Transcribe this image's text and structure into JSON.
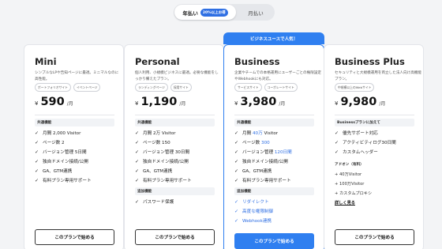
{
  "billing_toggle": {
    "annual_label": "年払い",
    "annual_badge": "20%以上お得",
    "monthly_label": "月払い"
  },
  "plans": [
    {
      "name": "Mini",
      "description": "シンプルなLPや告知ページに最適。ミニマルなのに高性能。",
      "tags": [
        "ポートフォリオサイト",
        "イベントページ"
      ],
      "currency": "¥",
      "price": "590",
      "per": "/月",
      "sections": [
        {
          "heading": "共通機能",
          "features": [
            {
              "text": "月間 2,000 Visitor"
            },
            {
              "text": "ページ数 2"
            },
            {
              "text": "バージョン管理 5日間"
            },
            {
              "text": "独自ドメイン接続/公開"
            },
            {
              "text": "GA、GTM連携"
            },
            {
              "text": "有料プラン専用サポート"
            }
          ]
        }
      ],
      "button": "このプランで始める"
    },
    {
      "name": "Personal",
      "description": "個人利用、小規模ビジネスに最適。必要な機能をしっかり備えたプラン。",
      "tags": [
        "ランディングページ",
        "採用サイト"
      ],
      "currency": "¥",
      "price": "1,190",
      "per": "/月",
      "sections": [
        {
          "heading": "共通機能",
          "features": [
            {
              "text": "月間 2万 Visitor"
            },
            {
              "text": "ページ数 150"
            },
            {
              "text": "バージョン管理 30日間"
            },
            {
              "text": "独自ドメイン接続/公開"
            },
            {
              "text": "GA、GTM連携"
            },
            {
              "text": "有料プラン専用サポート"
            }
          ]
        },
        {
          "heading": "追加機能",
          "features": [
            {
              "text": "パスワード保護"
            }
          ]
        }
      ],
      "button": "このプランで始める"
    },
    {
      "name": "Business",
      "banner": "ビジネスユースで人気！",
      "description": "企業やチームでの本格運用にユーザーごとの権限設定やWebhookにも対応。",
      "tags": [
        "サービスサイト",
        "コーポレートサイト"
      ],
      "currency": "¥",
      "price": "3,980",
      "per": "/月",
      "sections": [
        {
          "heading": "共通機能",
          "features": [
            {
              "text": "月間 ",
              "highlight": "40万",
              "suffix": " Visitor"
            },
            {
              "text": "ページ数 ",
              "highlight": "300",
              "suffix": ""
            },
            {
              "text": "バージョン管理 ",
              "highlight": "120日間",
              "suffix": ""
            },
            {
              "text": "独自ドメイン接続/公開"
            },
            {
              "text": "GA、GTM連携"
            },
            {
              "text": "有料プラン専用サポート"
            }
          ]
        },
        {
          "heading": "追加機能",
          "features": [
            {
              "text": "リダイレクト",
              "blue": true
            },
            {
              "text": "高度な権限制御",
              "blue": true
            },
            {
              "text": "Webhook連携",
              "blue": true
            }
          ]
        }
      ],
      "button": "このプランで始める"
    },
    {
      "name": "Business Plus",
      "description": "セキュリティと大規模運用を両立した法人向け高機能プラン。",
      "tags": [
        "中規模以上のWebサイト"
      ],
      "currency": "¥",
      "price": "9,980",
      "per": "/月",
      "sections": [
        {
          "heading": "Businessプランに加えて",
          "features": [
            {
              "text": "優先サポート対応"
            },
            {
              "text": "アクティビティログ30日間"
            },
            {
              "text": "カスタムヘッダー"
            }
          ]
        }
      ],
      "addon_label": "アドオン（有料）",
      "addons": [
        "+ 40万Visitor",
        "+ 100万Visitor",
        "+ カスタムプロキシ"
      ],
      "more_link": "詳しく見る",
      "button": "このプランで始める"
    }
  ]
}
